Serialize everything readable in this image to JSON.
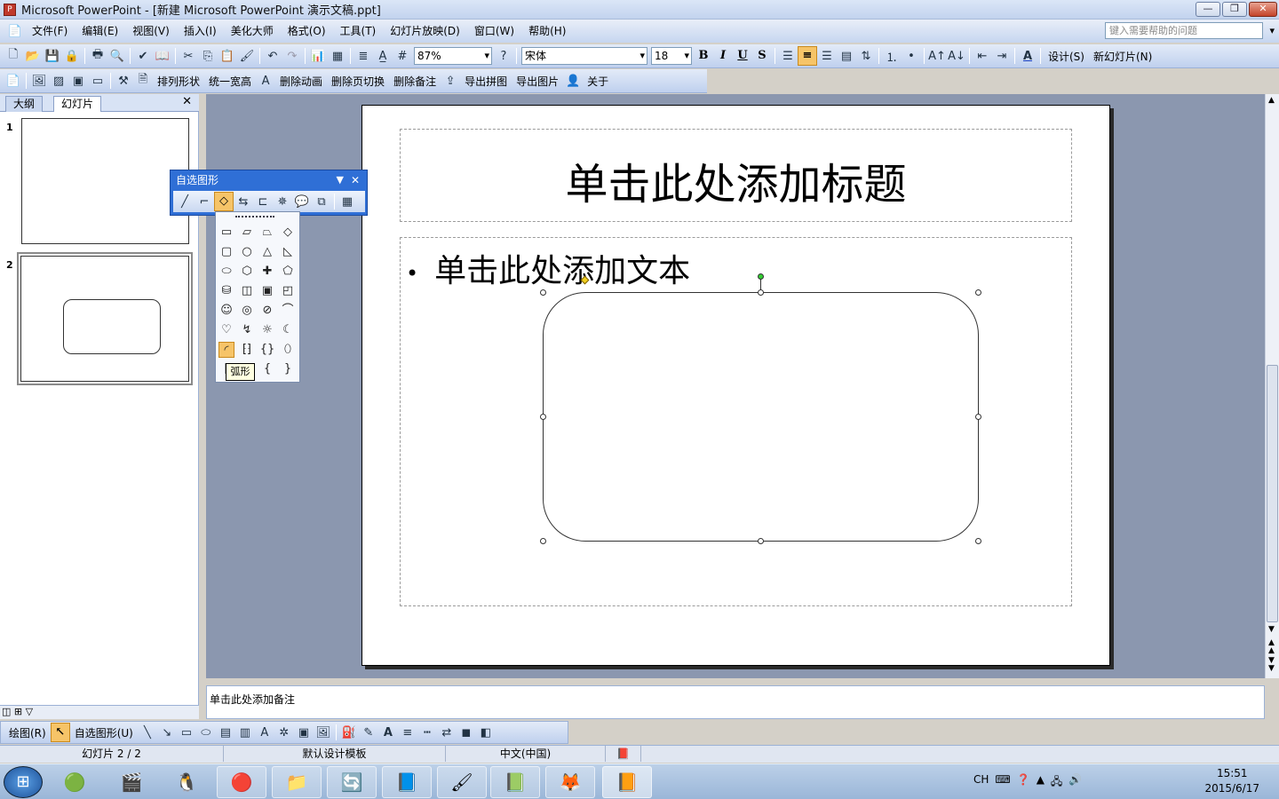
{
  "app": {
    "title": "Microsoft PowerPoint - [新建 Microsoft PowerPoint 演示文稿.ppt]",
    "icon": "P"
  },
  "window_buttons": {
    "minimize": "—",
    "restore": "❐",
    "close": "✕"
  },
  "menu": {
    "items": [
      "文件(F)",
      "编辑(E)",
      "视图(V)",
      "插入(I)",
      "美化大师",
      "格式(O)",
      "工具(T)",
      "幻灯片放映(D)",
      "窗口(W)",
      "帮助(H)"
    ],
    "help_placeholder": "键入需要帮助的问题"
  },
  "toolbar1": {
    "zoom": "87%",
    "font": "宋体",
    "font_size": "18",
    "bold": "B",
    "italic": "I",
    "underline": "U",
    "shadow": "S",
    "design": "设计(S)",
    "new_slide": "新幻灯片(N)"
  },
  "toolbar2": {
    "items": [
      "排列形状",
      "统一宽高",
      "删除动画",
      "删除页切换",
      "删除备注",
      "导出拼图",
      "导出图片",
      "关于"
    ]
  },
  "pane": {
    "tab_outline": "大纲",
    "tab_slides": "幻灯片",
    "close": "✕",
    "slide_numbers": [
      "1",
      "2"
    ]
  },
  "slide": {
    "title_placeholder": "单击此处添加标题",
    "body_placeholder": "单击此处添加文本",
    "bullet": "•"
  },
  "notes": {
    "placeholder": "单击此处添加备注"
  },
  "drawbar": {
    "draw_label": "绘图(R)",
    "autoshapes_label": "自选图形(U)"
  },
  "autoshapes_window": {
    "title": "自选图形",
    "tooltip": "弧形"
  },
  "statusbar": {
    "slide_index": "幻灯片 2 / 2",
    "template": "默认设计模板",
    "language": "中文(中国)"
  },
  "taskbar": {
    "tray_lang": "CH",
    "time": "15:51",
    "date": "2015/6/17"
  },
  "colors": {
    "accent": "#2f6fd6",
    "selected_button": "#f6c468",
    "workarea": "#8b97af"
  }
}
